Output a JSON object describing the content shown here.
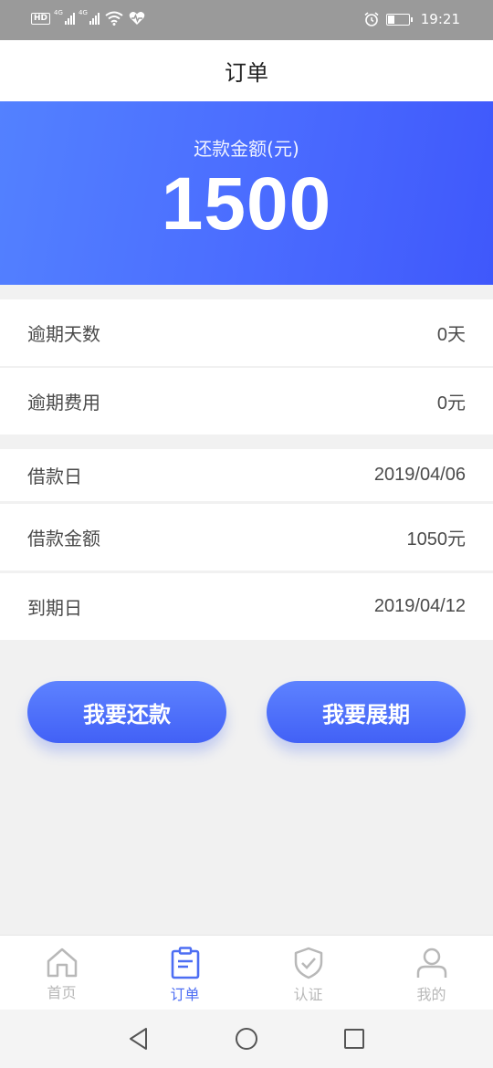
{
  "status_bar": {
    "hd": "HD",
    "sig1": "4G",
    "sig2": "4G",
    "time": "19:21"
  },
  "header": {
    "title": "订单"
  },
  "hero": {
    "label": "还款金额(元)",
    "amount": "1500"
  },
  "rows": [
    {
      "label": "逾期天数",
      "value": "0天"
    },
    {
      "label": "逾期费用",
      "value": "0元"
    },
    {
      "label": "借款日",
      "value": "2019/04/06"
    },
    {
      "label": "借款金额",
      "value": "1050元"
    },
    {
      "label": "到期日",
      "value": "2019/04/12"
    }
  ],
  "buttons": {
    "repay": "我要还款",
    "extend": "我要展期"
  },
  "tabs": [
    {
      "label": "首页",
      "icon": "home-icon",
      "active": false
    },
    {
      "label": "订单",
      "icon": "order-icon",
      "active": true
    },
    {
      "label": "认证",
      "icon": "shield-check-icon",
      "active": false
    },
    {
      "label": "我的",
      "icon": "user-icon",
      "active": false
    }
  ],
  "colors": {
    "accent": "#4d6ef3",
    "hero_start": "#5381ff",
    "hero_end": "#3f58fb",
    "inactive_tab": "#b8b8b8"
  }
}
